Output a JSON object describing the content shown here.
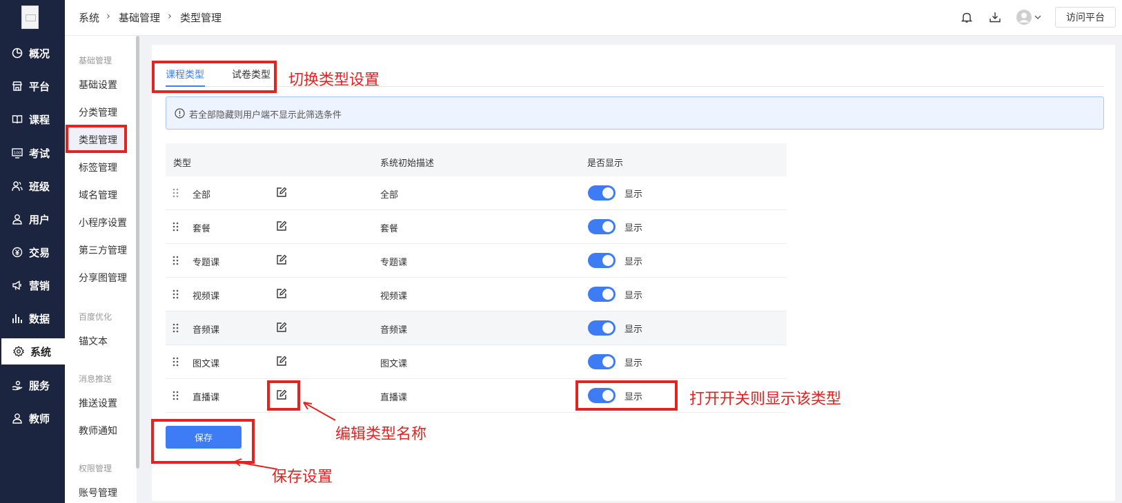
{
  "sidebar": {
    "items": [
      {
        "label": "概况",
        "icon": "clock-icon"
      },
      {
        "label": "平台",
        "icon": "store-icon"
      },
      {
        "label": "课程",
        "icon": "book-icon"
      },
      {
        "label": "考试",
        "icon": "exam-100-icon"
      },
      {
        "label": "班级",
        "icon": "users-icon"
      },
      {
        "label": "用户",
        "icon": "user-icon"
      },
      {
        "label": "交易",
        "icon": "currency-icon"
      },
      {
        "label": "营销",
        "icon": "megaphone-icon"
      },
      {
        "label": "数据",
        "icon": "bar-chart-icon"
      },
      {
        "label": "系统",
        "icon": "gear-icon",
        "active": true
      },
      {
        "label": "服务",
        "icon": "service-icon"
      },
      {
        "label": "教师",
        "icon": "teacher-icon"
      }
    ]
  },
  "submenu": {
    "group1": "基础管理",
    "items1": [
      "基础设置",
      "分类管理",
      "类型管理",
      "标签管理",
      "域名管理",
      "小程序设置",
      "第三方管理",
      "分享图管理"
    ],
    "group2": "百度优化",
    "items2": [
      "锚文本"
    ],
    "group3": "消息推送",
    "items3": [
      "推送设置",
      "教师通知"
    ],
    "group4": "权限管理",
    "items4": [
      "账号管理"
    ]
  },
  "header": {
    "breadcrumb": [
      "系统",
      "基础管理",
      "类型管理"
    ],
    "visit_label": "访问平台"
  },
  "tabs": [
    "课程类型",
    "试卷类型"
  ],
  "notice": "若全部隐藏则用户端不显示此筛选条件",
  "table": {
    "headers": [
      "类型",
      "系统初始描述",
      "是否显示"
    ],
    "rows": [
      {
        "name": "全部",
        "desc": "全部",
        "show": "显示"
      },
      {
        "name": "套餐",
        "desc": "套餐",
        "show": "显示"
      },
      {
        "name": "专题课",
        "desc": "专题课",
        "show": "显示"
      },
      {
        "name": "视频课",
        "desc": "视频课",
        "show": "显示"
      },
      {
        "name": "音频课",
        "desc": "音频课",
        "show": "显示"
      },
      {
        "name": "图文课",
        "desc": "图文课",
        "show": "显示"
      },
      {
        "name": "直播课",
        "desc": "直播课",
        "show": "显示"
      }
    ]
  },
  "save_label": "保存",
  "annotations": {
    "switch_tabs": "切换类型设置",
    "toggle_note": "打开开关则显示该类型",
    "edit_note": "编辑类型名称",
    "save_note": "保存设置"
  },
  "colors": {
    "accent": "#3e7cf6",
    "sidebar": "#1b2540",
    "annotation": "#e52222"
  }
}
